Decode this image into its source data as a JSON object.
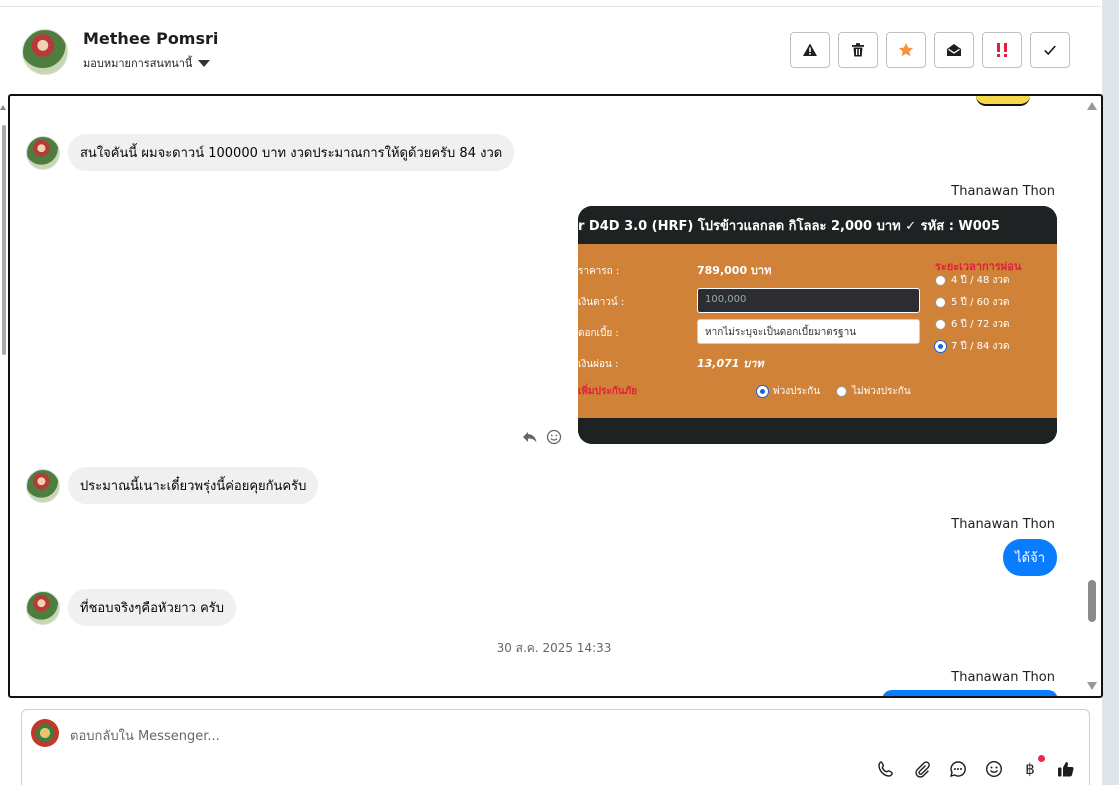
{
  "header": {
    "contact_name": "Methee Pomsri",
    "assign_label": "มอบหมายการสนทนานี้",
    "actions": [
      {
        "icon": "warning-icon"
      },
      {
        "icon": "trash-icon"
      },
      {
        "icon": "star-icon"
      },
      {
        "icon": "mark-read-icon"
      },
      {
        "icon": "priority-icon"
      },
      {
        "icon": "check-icon"
      }
    ]
  },
  "conversation": {
    "messages": [
      {
        "direction": "in",
        "text": "สนใจคันนี้  ผมจะดาวน์ 100000 บาท   งวดประมาณการให้ดูด้วยครับ  84  งวด"
      },
      {
        "direction": "out",
        "sender": "Thanawan Thon",
        "type": "image"
      },
      {
        "direction": "in",
        "text": "ประมาณนี้เนาะเดี๋ยวพรุ่งนี้ค่อยคุยกันครับ"
      },
      {
        "direction": "out",
        "sender": "Thanawan Thon",
        "text": "ได้จ้า"
      },
      {
        "direction": "in",
        "text": "ที่ชอบจริงๆคือหัวยาว  ครับ"
      },
      {
        "direction": "out",
        "sender": "Thanawan Thon"
      }
    ],
    "timestamp": "30 ส.ค. 2025 14:33"
  },
  "image_card": {
    "title": "r D4D 3.0 (HRF) โปรข้าวแลกลด กิโลละ 2,000 บาท ✓ รหัส : W005",
    "price_label": "ราคารถ :",
    "price_value": "789,000 บาท",
    "down_label": "เงินดาวน์ :",
    "down_value": "100,000",
    "interest_label": "ดอกเบี้ย :",
    "interest_value": "หากไม่ระบุจะเป็นดอกเบี้ยมาตรฐาน",
    "installment_label": "เงินผ่อน :",
    "installment_value": "13,071 บาท",
    "period_title": "ระยะเวลาการผ่อน",
    "periods": [
      {
        "label": "4 ปี / 48 งวด",
        "selected": false
      },
      {
        "label": "5 ปี / 60 งวด",
        "selected": false
      },
      {
        "label": "6 ปี / 72 งวด",
        "selected": false
      },
      {
        "label": "7 ปี / 84 งวด",
        "selected": true
      }
    ],
    "insurance_label": "เพิ่มประกันภัย",
    "insurance_options": [
      {
        "label": "พ่วงประกัน",
        "selected": true
      },
      {
        "label": "ไม่พ่วงประกัน",
        "selected": false
      }
    ]
  },
  "composer": {
    "placeholder": "ตอบกลับใน Messenger...",
    "tools": [
      "phone-icon",
      "attach-icon",
      "chat-icon",
      "emoji-icon",
      "baht-icon",
      "like-icon"
    ]
  },
  "colors": {
    "accent": "#0a7cff",
    "incoming_bubble": "#f0f0f0",
    "star": "#f7923a",
    "priority": "#e0213a",
    "card_body": "#cf8238"
  }
}
